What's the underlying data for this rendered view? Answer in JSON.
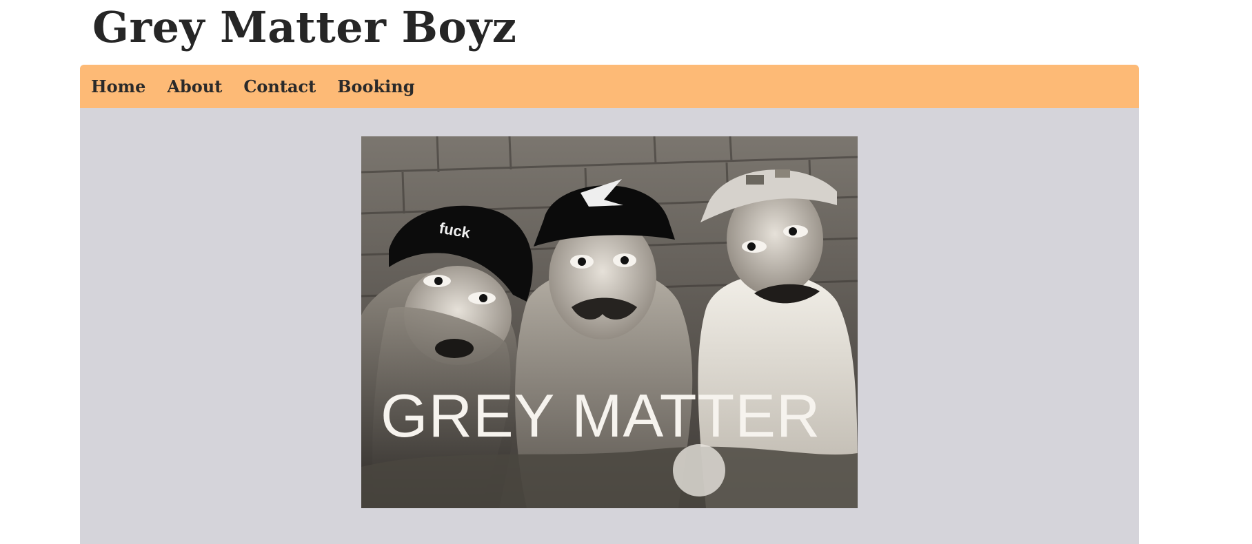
{
  "site": {
    "title": "Grey Matter Boyz"
  },
  "nav": {
    "items": [
      {
        "label": "Home"
      },
      {
        "label": "About"
      },
      {
        "label": "Contact"
      },
      {
        "label": "Booking"
      }
    ]
  },
  "hero": {
    "caption": "GREY MATTER",
    "hat_text": "fuck"
  },
  "colors": {
    "nav_background": "#fdba76",
    "content_background": "#d5d4da",
    "title_text": "#262626",
    "nav_text": "#2a2a2a"
  }
}
